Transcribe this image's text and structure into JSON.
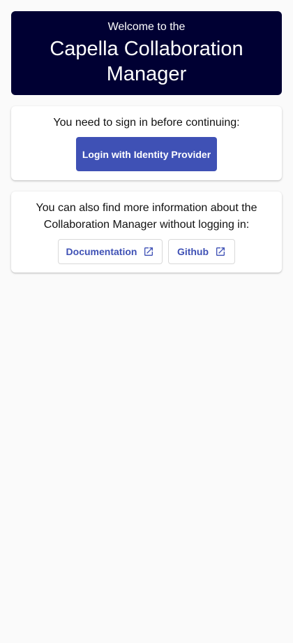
{
  "hero": {
    "kicker": "Welcome to the",
    "title_line1": "Capella Collaboration",
    "title_line2": "Manager"
  },
  "signin": {
    "prompt": "You need to sign in before continuing:",
    "login_label": "Login with Identity Provider"
  },
  "info": {
    "line1": "You can also find more information about the",
    "line2": "Collaboration Manager without logging in:",
    "links": [
      {
        "label": "Documentation",
        "icon": "open-in-new-icon"
      },
      {
        "label": "Github",
        "icon": "open-in-new-icon"
      }
    ]
  },
  "colors": {
    "hero_bg": "#000033",
    "primary": "#3f51b5",
    "page_bg": "#fafafa"
  }
}
